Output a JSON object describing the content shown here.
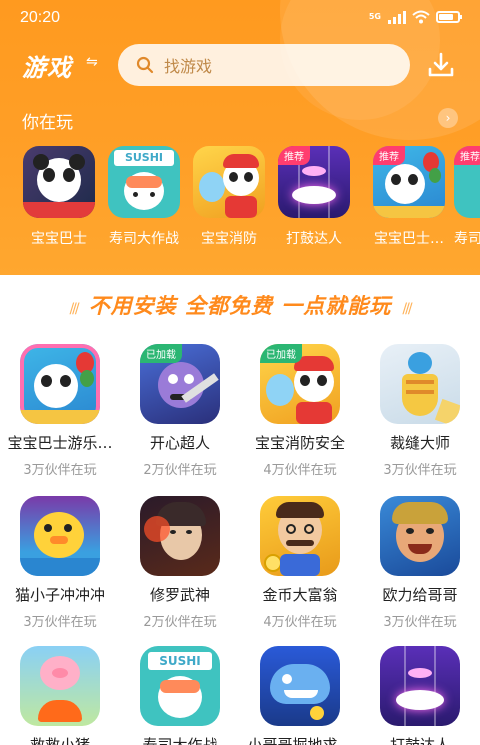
{
  "status": {
    "time": "20:20",
    "network": "5G"
  },
  "header": {
    "title": "游戏",
    "search_placeholder": "找游戏"
  },
  "playing": {
    "title": "你在玩",
    "items": [
      {
        "label": "宝宝巴士",
        "tag": "",
        "icon": "panda-bus-icon"
      },
      {
        "label": "寿司大作战",
        "tag": "",
        "icon": "sushi-icon"
      },
      {
        "label": "宝宝消防",
        "tag": "",
        "icon": "panda-firefighter-icon"
      },
      {
        "label": "打鼓达人",
        "tag": "推荐",
        "icon": "drum-tiles-icon"
      },
      {
        "label": "宝宝巴士…",
        "tag": "推荐",
        "icon": "panda-balloon-icon"
      },
      {
        "label": "寿司",
        "tag": "推荐",
        "icon": "sushi-icon"
      }
    ]
  },
  "banner": {
    "text": "不用安装 全都免费 一点就能玩"
  },
  "games": [
    {
      "name": "宝宝巴士游乐…",
      "players": "3万伙伴在玩",
      "tag": "",
      "icon": "panda-balloon-icon"
    },
    {
      "name": "开心超人",
      "players": "2万伙伴在玩",
      "tag": "已加载",
      "icon": "hero-icon"
    },
    {
      "name": "宝宝消防安全",
      "players": "4万伙伴在玩",
      "tag": "已加载",
      "icon": "panda-firefighter-icon"
    },
    {
      "name": "裁缝大师",
      "players": "3万伙伴在玩",
      "tag": "",
      "icon": "tailor-icon"
    },
    {
      "name": "猫小子冲冲冲",
      "players": "3万伙伴在玩",
      "tag": "",
      "icon": "duck-icon"
    },
    {
      "name": "修罗武神",
      "players": "2万伙伴在玩",
      "tag": "",
      "icon": "warrior-icon"
    },
    {
      "name": "金币大富翁",
      "players": "4万伙伴在玩",
      "tag": "",
      "icon": "tycoon-icon"
    },
    {
      "name": "欧力给哥哥",
      "players": "3万伙伴在玩",
      "tag": "",
      "icon": "fighter-icon"
    },
    {
      "name": "救救小猪",
      "players": "",
      "tag": "",
      "icon": "pig-icon"
    },
    {
      "name": "寿司大作战",
      "players": "",
      "tag": "",
      "icon": "sushi-icon"
    },
    {
      "name": "小哥哥掘地求…",
      "players": "",
      "tag": "",
      "icon": "shark-icon"
    },
    {
      "name": "打鼓达人",
      "players": "",
      "tag": "",
      "icon": "drum-tiles-icon"
    }
  ],
  "colors": {
    "brand": "#ff9a1f",
    "banner_text": "#ff8a1c",
    "loaded_tag": "#2bb673",
    "recommend_tag": "#ff3d6f"
  }
}
